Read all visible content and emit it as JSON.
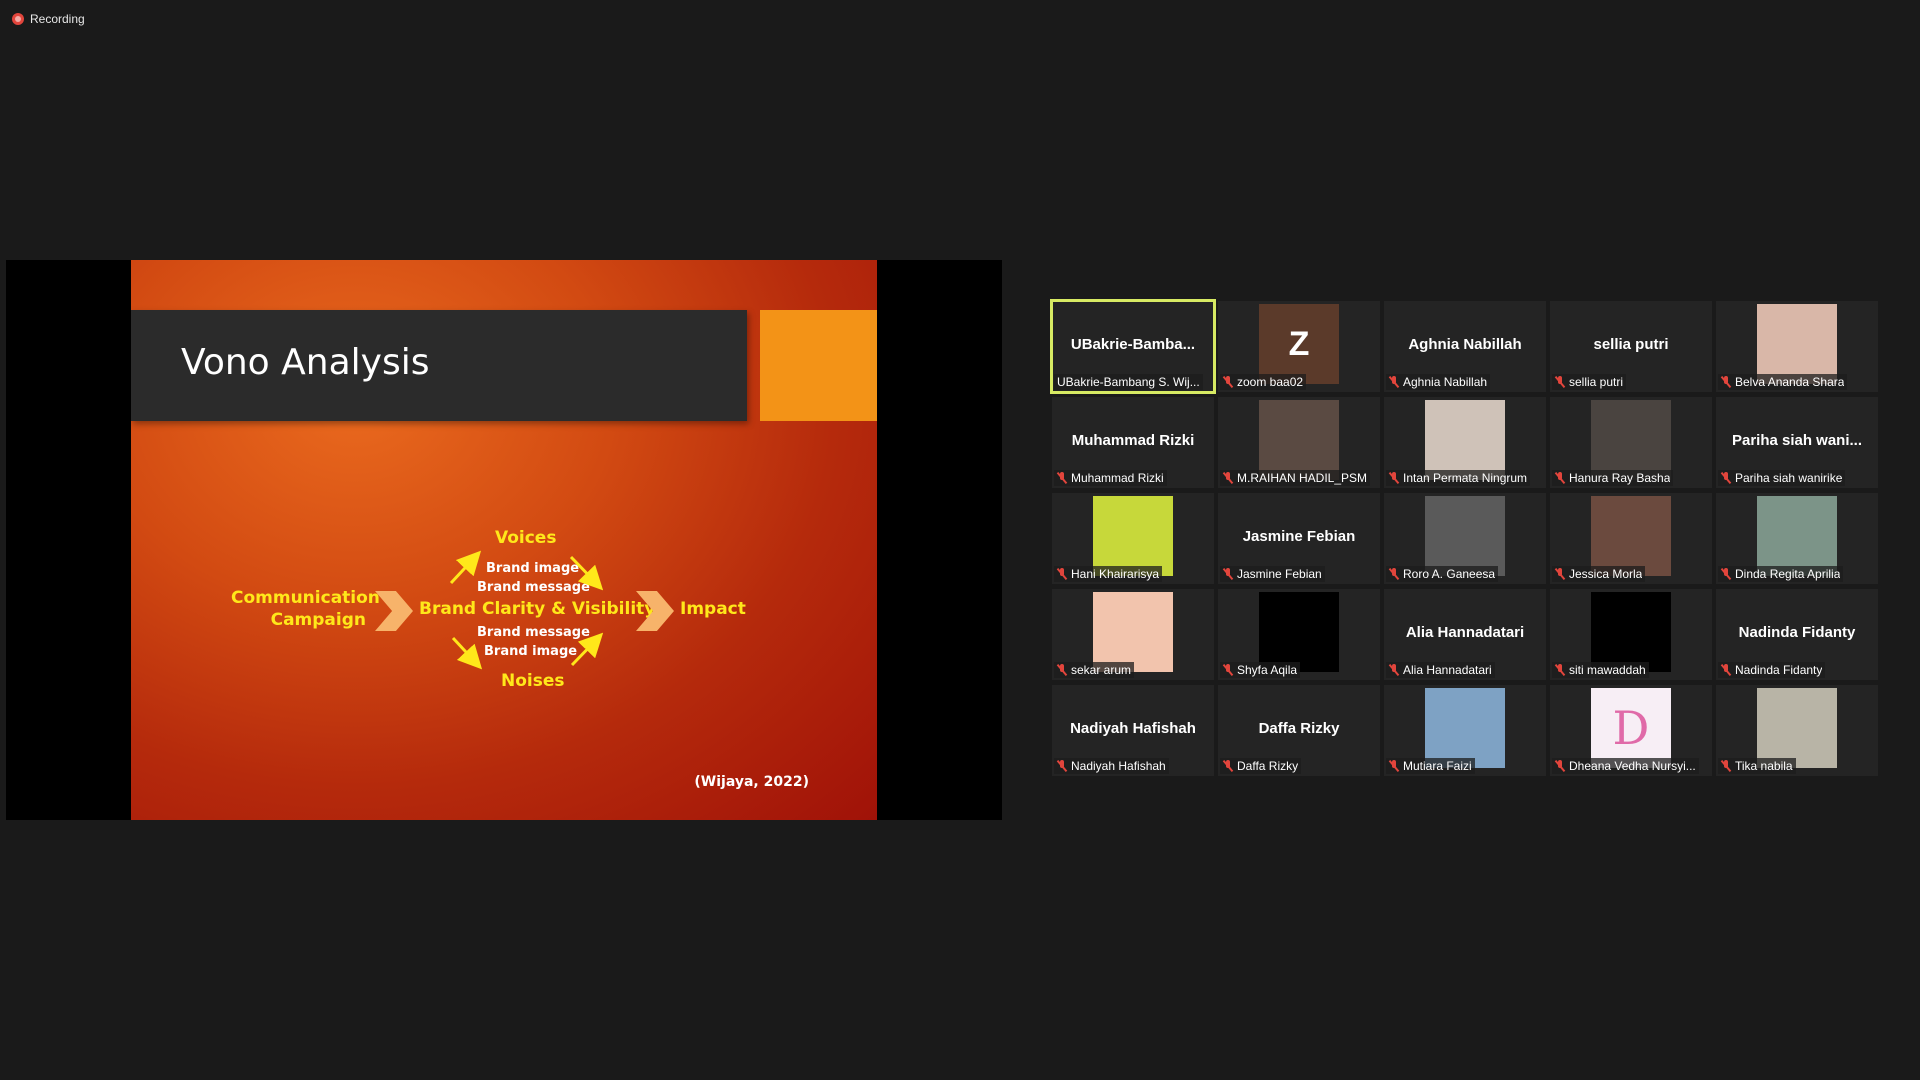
{
  "recording": {
    "label": "Recording",
    "color": "#e2453c"
  },
  "slide": {
    "title": "Vono Analysis",
    "diagram": {
      "left_line1": "Communication",
      "left_line2": "Campaign",
      "center": "Brand Clarity & Visibility",
      "right": "Impact",
      "top": "Voices",
      "top_items": [
        "Brand image",
        "Brand message"
      ],
      "bottom_items": [
        "Brand message",
        "Brand image"
      ],
      "bottom": "Noises"
    },
    "citation": "(Wijaya, 2022)",
    "colors": {
      "title_bar": "#2b2b2b",
      "accent": "#f39317",
      "diagram_text": "#ffe81a",
      "chevron": "#f7b36a"
    }
  },
  "participants": [
    {
      "display": "UBakrie-Bamba...",
      "label": "UBakrie-Bambang S. Wij...",
      "muted": false,
      "active": true,
      "thumb": "name"
    },
    {
      "display": "Z",
      "label": "zoom baa02",
      "muted": true,
      "thumb": "letter",
      "color": "#5b3a2a"
    },
    {
      "display": "Aghnia Nabillah",
      "label": "Aghnia Nabillah",
      "muted": true,
      "thumb": "name"
    },
    {
      "display": "sellia putri",
      "label": "sellia putri",
      "muted": true,
      "thumb": "name"
    },
    {
      "display": "",
      "label": "Belva Ananda Shara",
      "muted": true,
      "thumb": "photo",
      "color": "#d9b7a8"
    },
    {
      "display": "Muhammad Rizki",
      "label": "Muhammad Rizki",
      "muted": true,
      "thumb": "name"
    },
    {
      "display": "",
      "label": "M.RAIHAN HADIL_PSM",
      "muted": true,
      "thumb": "photo",
      "color": "#5a4a42"
    },
    {
      "display": "",
      "label": "Intan Permata Ningrum",
      "muted": true,
      "thumb": "photo",
      "color": "#cfc2b8"
    },
    {
      "display": "",
      "label": "Hanura Ray Basha",
      "muted": true,
      "thumb": "photo",
      "color": "#4a4440"
    },
    {
      "display": "Pariha siah wani...",
      "label": "Pariha siah wanirike",
      "muted": true,
      "thumb": "name"
    },
    {
      "display": "",
      "label": "Hani Khairarisya",
      "muted": true,
      "thumb": "photo",
      "color": "#c7d83a"
    },
    {
      "display": "Jasmine Febian",
      "label": "Jasmine Febian",
      "muted": true,
      "thumb": "name"
    },
    {
      "display": "",
      "label": "Roro A. Ganeesa",
      "muted": true,
      "thumb": "photo",
      "color": "#5a5a5a"
    },
    {
      "display": "",
      "label": "Jessica Morla",
      "muted": true,
      "thumb": "photo",
      "color": "#6b4a3e"
    },
    {
      "display": "",
      "label": "Dinda Regita Aprilia",
      "muted": true,
      "thumb": "photo",
      "color": "#7c9488"
    },
    {
      "display": "",
      "label": "sekar arum",
      "muted": true,
      "thumb": "photo",
      "color": "#f2c4ad"
    },
    {
      "display": "",
      "label": "Shyfa Aqila",
      "muted": true,
      "thumb": "photo",
      "color": "#000000"
    },
    {
      "display": "Alia Hannadatari",
      "label": "Alia Hannadatari",
      "muted": true,
      "thumb": "name"
    },
    {
      "display": "",
      "label": "siti mawaddah",
      "muted": true,
      "thumb": "photo",
      "color": "#000000"
    },
    {
      "display": "Nadinda Fidanty",
      "label": "Nadinda Fidanty",
      "muted": true,
      "thumb": "name"
    },
    {
      "display": "Nadiyah Hafishah",
      "label": "Nadiyah Hafishah",
      "muted": true,
      "thumb": "name"
    },
    {
      "display": "Daffa Rizky",
      "label": "Daffa Rizky",
      "muted": true,
      "thumb": "name"
    },
    {
      "display": "",
      "label": "Mutiara Faizi",
      "muted": true,
      "thumb": "photo",
      "color": "#7ea2c4"
    },
    {
      "display": "D",
      "label": "Dheana Vedha Nursyi...",
      "muted": true,
      "thumb": "photo-letter",
      "color": "#f7eef5"
    },
    {
      "display": "",
      "label": "Tika nabila",
      "muted": true,
      "thumb": "photo",
      "color": "#b8b4a6"
    }
  ]
}
